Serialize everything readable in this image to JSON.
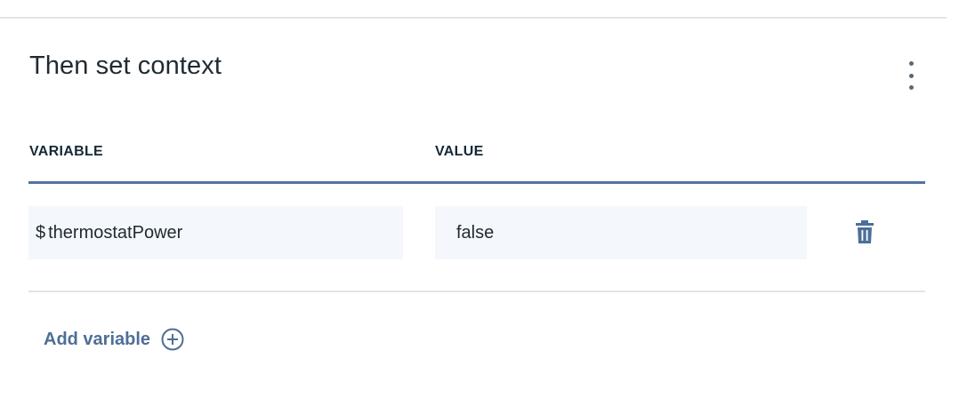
{
  "section": {
    "title": "Then set context"
  },
  "table": {
    "headers": {
      "variable": "VARIABLE",
      "value": "VALUE"
    },
    "rows": [
      {
        "prefix": "$",
        "variable": "thermostatPower",
        "value": "false"
      }
    ]
  },
  "actions": {
    "add_variable_label": "Add variable"
  },
  "icons": {
    "overflow": "overflow-menu-vertical-icon",
    "delete": "trash-icon",
    "add": "add-circle-icon"
  },
  "colors": {
    "accent": "#5374a1",
    "link": "#4d6e98",
    "field_bg": "#f4f7fb",
    "divider": "#e2e4e7"
  }
}
